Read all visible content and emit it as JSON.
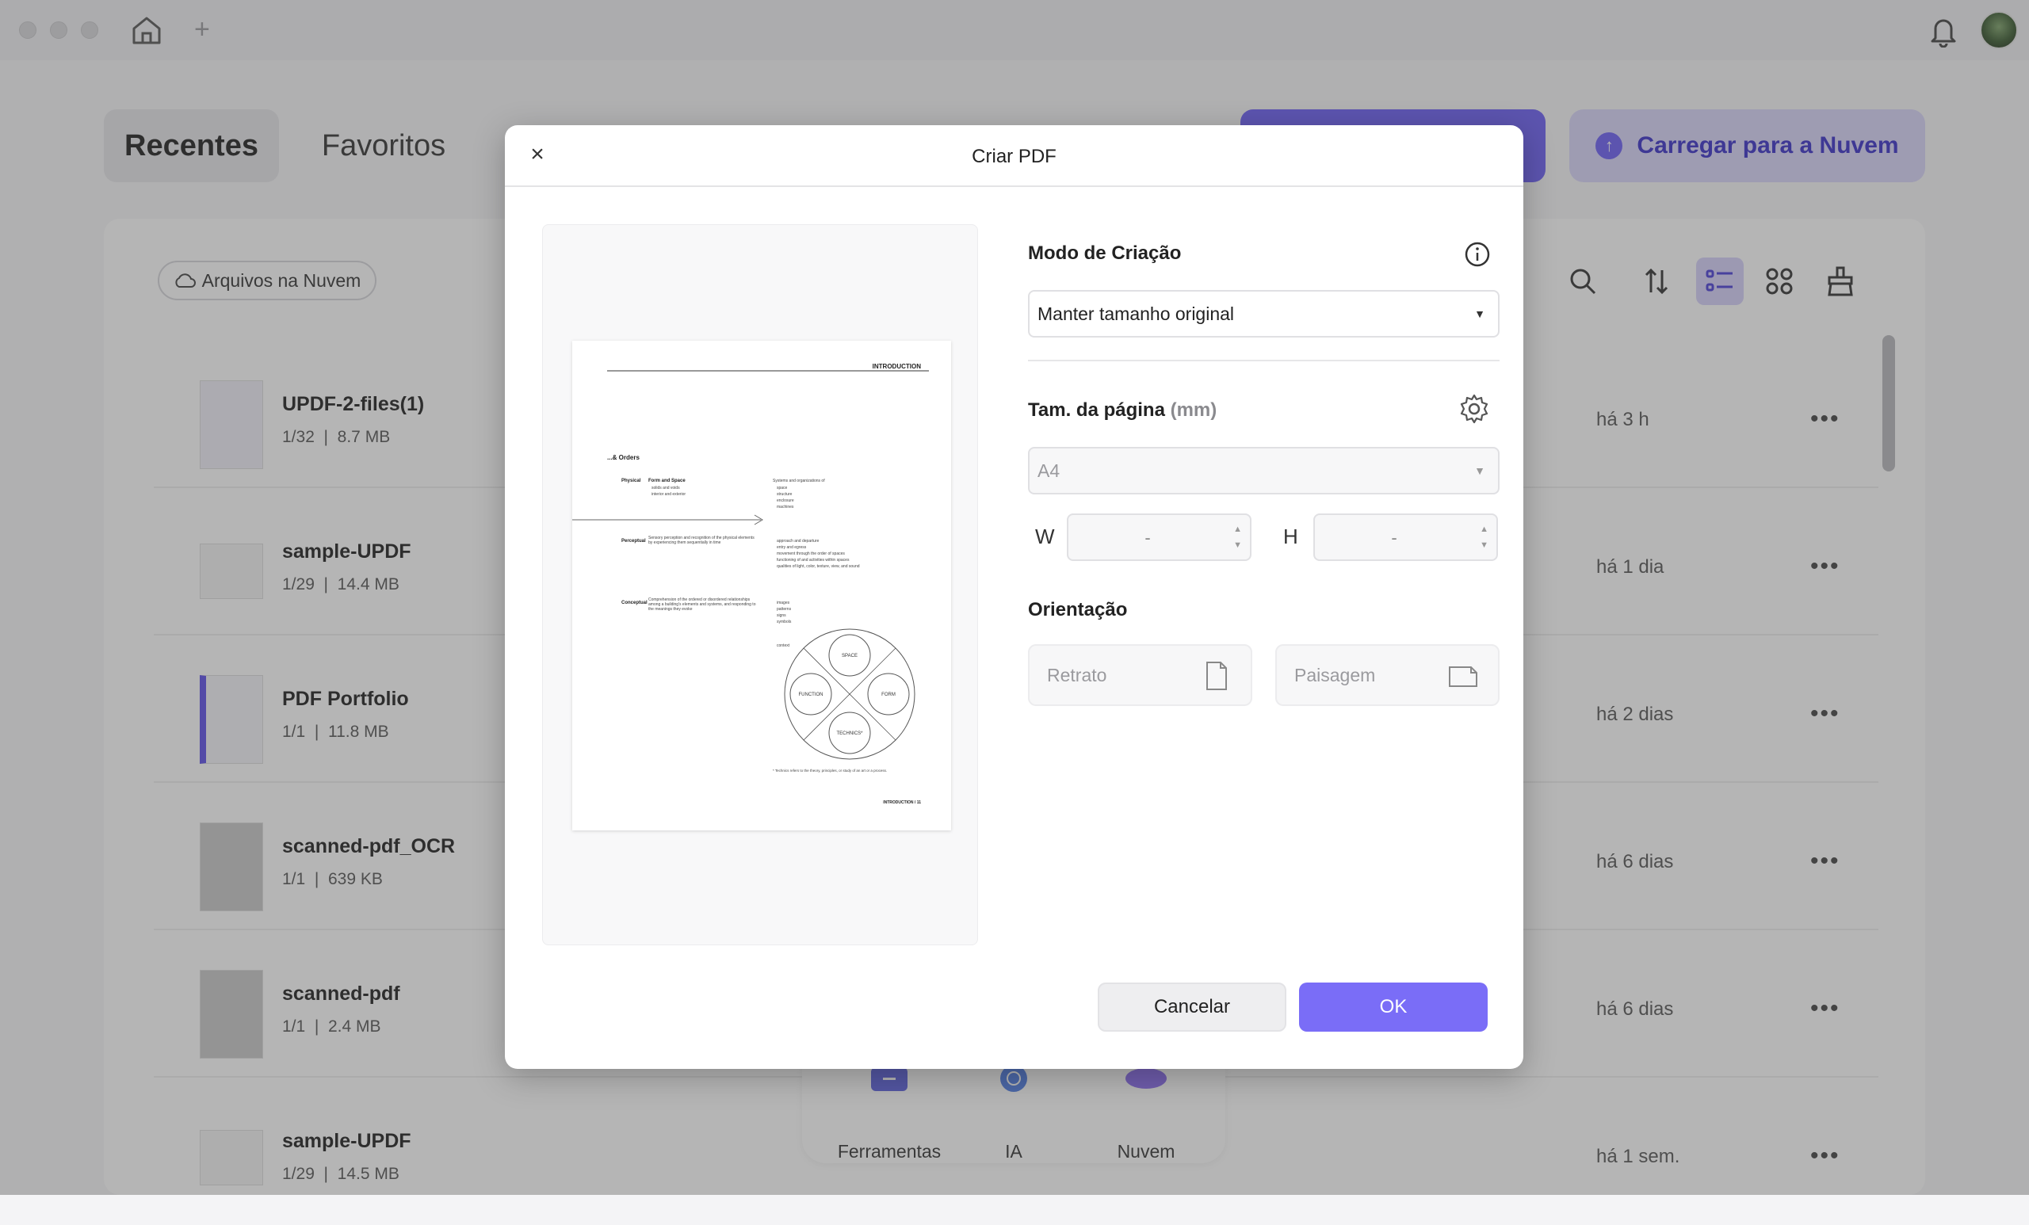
{
  "app": {
    "tabs": [
      {
        "label": "Recentes"
      },
      {
        "label": "Favoritos"
      }
    ],
    "upload_cloud_label": "Carregar para a Nuvem",
    "cloud_files_label": "Arquivos na Nuvem",
    "accent_color": "#6b5ef5"
  },
  "files": [
    {
      "name": "UPDF-2-files(1)",
      "pages": "1/32",
      "size": "8.7 MB",
      "time": "há 3 h"
    },
    {
      "name": "sample-UPDF",
      "pages": "1/29",
      "size": "14.4 MB",
      "time": "há 1 dia"
    },
    {
      "name": "PDF Portfolio",
      "pages": "1/1",
      "size": "11.8 MB",
      "time": "há 2 dias"
    },
    {
      "name": "scanned-pdf_OCR",
      "pages": "1/1",
      "size": "639 KB",
      "time": "há 6 dias"
    },
    {
      "name": "scanned-pdf",
      "pages": "1/1",
      "size": "2.4 MB",
      "time": "há 6 dias"
    },
    {
      "name": "sample-UPDF",
      "pages": "1/29",
      "size": "14.5 MB",
      "time": "há 1 sem."
    }
  ],
  "dock": [
    {
      "label": "Ferramentas",
      "icon": "tools-icon"
    },
    {
      "label": "IA",
      "icon": "ai-icon"
    },
    {
      "label": "Nuvem",
      "icon": "cloud-icon"
    }
  ],
  "dialog": {
    "title": "Criar PDF",
    "creation_mode_label": "Modo de Criação",
    "creation_mode_value": "Manter tamanho original",
    "page_size_label": "Tam. da página",
    "page_size_unit": "(mm)",
    "page_size_value": "A4",
    "width_letter": "W",
    "height_letter": "H",
    "width_value": "-",
    "height_value": "-",
    "orientation_label": "Orientação",
    "portrait_label": "Retrato",
    "landscape_label": "Paisagem",
    "cancel_label": "Cancelar",
    "ok_label": "OK"
  },
  "preview": {
    "header": "INTRODUCTION",
    "section": "...& Orders",
    "rows": [
      {
        "term": "Physical",
        "heading": "Form and Space",
        "items": [
          "solids and voids",
          "interior and exterior"
        ]
      },
      {
        "term": "Perceptual",
        "heading": "Sensory perception and recognition of the physical elements by experiencing them sequentially in time",
        "items": []
      },
      {
        "term": "Conceptual",
        "heading": "Comprehension of the ordered or disordered relationships among a building's elements and systems, and responding to the meanings they evoke",
        "items": []
      }
    ],
    "right_col_title": "Systems and organizations of",
    "right_col_items_1": [
      "space",
      "structure",
      "enclosure",
      "machines"
    ],
    "right_col_items_2": [
      "approach and departure",
      "entry and egress",
      "movement through the order of spaces",
      "functioning of and activities within spaces",
      "qualities of light, color, texture, view, and sound"
    ],
    "right_col_items_3": [
      "images",
      "patterns",
      "signs",
      "symbols"
    ],
    "right_col_context": "context",
    "diagram_labels": [
      "SPACE",
      "FUNCTION",
      "FORM",
      "TECHNICS*"
    ],
    "footnote": "* Technics refers to the theory, principles, or study of an art or a process.",
    "footer": "INTRODUCTION / 11"
  }
}
